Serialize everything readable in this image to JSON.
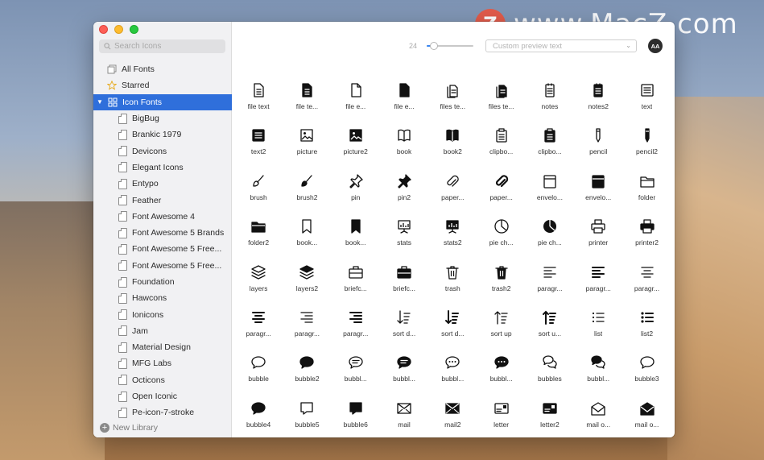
{
  "watermark": {
    "logo_letter": "Z",
    "text": "www.MacZ.com"
  },
  "window": {
    "search": {
      "placeholder": "Search Icons"
    },
    "sidebar": {
      "top_items": [
        {
          "label": "All Fonts",
          "icon": "fonts-stack-icon"
        },
        {
          "label": "Starred",
          "icon": "star-icon"
        }
      ],
      "group": {
        "label": "Icon Fonts",
        "icon": "grid-icon",
        "expanded": true
      },
      "fonts": [
        "BigBug",
        "Brankic 1979",
        "Devicons",
        "Elegant Icons",
        "Entypo",
        "Feather",
        "Font Awesome 4",
        "Font Awesome 5 Brands",
        "Font Awesome 5 Free...",
        "Font Awesome 5 Free...",
        "Foundation",
        "Hawcons",
        "Ionicons",
        "Jam",
        "Material Design",
        "MFG Labs",
        "Octicons",
        "Open Iconic",
        "Pe-icon-7-stroke"
      ],
      "new_library": "New Library"
    },
    "toolbar": {
      "size_value": "24",
      "slider_fraction": 0.15,
      "preview_placeholder": "Custom preview text",
      "aa_label": "AA"
    },
    "icons": [
      {
        "label": "file text",
        "glyph": "file-text",
        "filled": false
      },
      {
        "label": "file te...",
        "glyph": "file-text",
        "filled": true
      },
      {
        "label": "file e...",
        "glyph": "file",
        "filled": false
      },
      {
        "label": "file e...",
        "glyph": "file",
        "filled": true
      },
      {
        "label": "files te...",
        "glyph": "files",
        "filled": false
      },
      {
        "label": "files te...",
        "glyph": "files",
        "filled": true
      },
      {
        "label": "notes",
        "glyph": "notes",
        "filled": false
      },
      {
        "label": "notes2",
        "glyph": "notes",
        "filled": true
      },
      {
        "label": "text",
        "glyph": "text",
        "filled": false
      },
      {
        "label": "text2",
        "glyph": "text",
        "filled": true
      },
      {
        "label": "picture",
        "glyph": "picture",
        "filled": false
      },
      {
        "label": "picture2",
        "glyph": "picture",
        "filled": true
      },
      {
        "label": "book",
        "glyph": "book",
        "filled": false
      },
      {
        "label": "book2",
        "glyph": "book",
        "filled": true
      },
      {
        "label": "clipbo...",
        "glyph": "clipboard",
        "filled": false
      },
      {
        "label": "clipbo...",
        "glyph": "clipboard",
        "filled": true
      },
      {
        "label": "pencil",
        "glyph": "pencil",
        "filled": false
      },
      {
        "label": "pencil2",
        "glyph": "pencil",
        "filled": true
      },
      {
        "label": "brush",
        "glyph": "brush",
        "filled": false
      },
      {
        "label": "brush2",
        "glyph": "brush",
        "filled": true
      },
      {
        "label": "pin",
        "glyph": "pin",
        "filled": false
      },
      {
        "label": "pin2",
        "glyph": "pin",
        "filled": true
      },
      {
        "label": "paper...",
        "glyph": "paperclip",
        "filled": false
      },
      {
        "label": "paper...",
        "glyph": "paperclip",
        "filled": true
      },
      {
        "label": "envelo...",
        "glyph": "envelope-box",
        "filled": false
      },
      {
        "label": "envelo...",
        "glyph": "envelope-box",
        "filled": true
      },
      {
        "label": "folder",
        "glyph": "folder",
        "filled": false
      },
      {
        "label": "folder2",
        "glyph": "folder",
        "filled": true
      },
      {
        "label": "book...",
        "glyph": "bookmark",
        "filled": false
      },
      {
        "label": "book...",
        "glyph": "bookmark",
        "filled": true
      },
      {
        "label": "stats",
        "glyph": "stats",
        "filled": false
      },
      {
        "label": "stats2",
        "glyph": "stats",
        "filled": true
      },
      {
        "label": "pie ch...",
        "glyph": "pie",
        "filled": false
      },
      {
        "label": "pie ch...",
        "glyph": "pie",
        "filled": true
      },
      {
        "label": "printer",
        "glyph": "printer",
        "filled": false
      },
      {
        "label": "printer2",
        "glyph": "printer",
        "filled": true
      },
      {
        "label": "layers",
        "glyph": "layers",
        "filled": false
      },
      {
        "label": "layers2",
        "glyph": "layers",
        "filled": true
      },
      {
        "label": "briefc...",
        "glyph": "briefcase",
        "filled": false
      },
      {
        "label": "briefc...",
        "glyph": "briefcase",
        "filled": true
      },
      {
        "label": "trash",
        "glyph": "trash",
        "filled": false
      },
      {
        "label": "trash2",
        "glyph": "trash",
        "filled": true
      },
      {
        "label": "paragr...",
        "glyph": "para-left",
        "filled": false
      },
      {
        "label": "paragr...",
        "glyph": "para-left",
        "filled": true
      },
      {
        "label": "paragr...",
        "glyph": "para-center",
        "filled": false
      },
      {
        "label": "paragr...",
        "glyph": "para-center",
        "filled": true
      },
      {
        "label": "paragr...",
        "glyph": "para-right",
        "filled": false
      },
      {
        "label": "paragr...",
        "glyph": "para-right",
        "filled": true
      },
      {
        "label": "sort d...",
        "glyph": "sort-down",
        "filled": false
      },
      {
        "label": "sort d...",
        "glyph": "sort-down",
        "filled": true
      },
      {
        "label": "sort up",
        "glyph": "sort-up",
        "filled": false
      },
      {
        "label": "sort u...",
        "glyph": "sort-up",
        "filled": true
      },
      {
        "label": "list",
        "glyph": "list",
        "filled": false
      },
      {
        "label": "list2",
        "glyph": "list",
        "filled": true
      },
      {
        "label": "bubble",
        "glyph": "bubble",
        "filled": false
      },
      {
        "label": "bubble2",
        "glyph": "bubble",
        "filled": true
      },
      {
        "label": "bubbl...",
        "glyph": "bubble-lines",
        "filled": false
      },
      {
        "label": "bubbl...",
        "glyph": "bubble-lines",
        "filled": true
      },
      {
        "label": "bubbl...",
        "glyph": "bubble-dots",
        "filled": false
      },
      {
        "label": "bubbl...",
        "glyph": "bubble-dots",
        "filled": true
      },
      {
        "label": "bubbles",
        "glyph": "bubbles",
        "filled": false
      },
      {
        "label": "bubbl...",
        "glyph": "bubbles",
        "filled": true
      },
      {
        "label": "bubble3",
        "glyph": "bubble",
        "filled": false
      },
      {
        "label": "bubble4",
        "glyph": "bubble",
        "filled": true
      },
      {
        "label": "bubble5",
        "glyph": "bubble-square",
        "filled": false
      },
      {
        "label": "bubble6",
        "glyph": "bubble-square",
        "filled": true
      },
      {
        "label": "mail",
        "glyph": "mail",
        "filled": false
      },
      {
        "label": "mail2",
        "glyph": "mail",
        "filled": true
      },
      {
        "label": "letter",
        "glyph": "letter",
        "filled": false
      },
      {
        "label": "letter2",
        "glyph": "letter",
        "filled": true
      },
      {
        "label": "mail o...",
        "glyph": "mail-open",
        "filled": false
      },
      {
        "label": "mail o...",
        "glyph": "mail-open",
        "filled": true
      }
    ]
  },
  "colors": {
    "selection": "#2f6fdb",
    "icon": "#111111",
    "slider_accent": "#3a86f0"
  }
}
